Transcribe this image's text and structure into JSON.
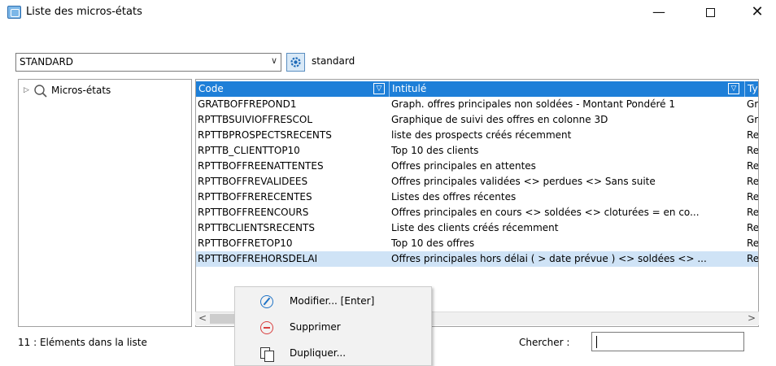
{
  "window": {
    "title": "Liste des micros-états",
    "minimize_glyph": "—",
    "close_glyph": "✕"
  },
  "toolbar": {
    "view_value": "STANDARD",
    "view_name": "standard",
    "dropdown_glyph": "∨"
  },
  "tree": {
    "expand_glyph": "▷",
    "root_label": "Micros-états"
  },
  "grid": {
    "columns": {
      "code": "Code",
      "intitule": "Intitulé",
      "type": "Ty"
    },
    "rows": [
      {
        "code": "GRATBOFFREPOND1",
        "intitule": "Graph. offres principales non soldées - Montant Pondéré 1",
        "type": "Gr"
      },
      {
        "code": "RPTTBSUIVIOFFRESCOL",
        "intitule": "Graphique de suivi des offres en colonne 3D",
        "type": "Gr"
      },
      {
        "code": "RPTTBPROSPECTSRECENTS",
        "intitule": "liste des prospects créés récemment",
        "type": "Re"
      },
      {
        "code": "RPTTB_CLIENTTOP10",
        "intitule": "Top 10 des clients",
        "type": "Re"
      },
      {
        "code": "RPTTBOFFREENATTENTES",
        "intitule": "Offres principales en attentes",
        "type": "Re"
      },
      {
        "code": "RPTTBOFFREVALIDEES",
        "intitule": "Offres principales validées <> perdues <> Sans suite",
        "type": "Re"
      },
      {
        "code": "RPTTBOFFRERECENTES",
        "intitule": "Listes des offres récentes",
        "type": "Re"
      },
      {
        "code": "RPTTBOFFREENCOURS",
        "intitule": "Offres principales en cours <> soldées <> cloturées = en co...",
        "type": "Re"
      },
      {
        "code": "RPTTBCLIENTSRECENTS",
        "intitule": "Liste des clients créés récemment",
        "type": "Re"
      },
      {
        "code": "RPTTBOFFRETOP10",
        "intitule": "Top 10 des offres",
        "type": "Re"
      },
      {
        "code": "RPTTBOFFREHORSDELAI",
        "intitule": "Offres principales hors délai ( > date prévue ) <> soldées <> ...",
        "type": "Re"
      }
    ],
    "scroll_left": "<",
    "scroll_right": ">"
  },
  "footer": {
    "count_text": "11 : Eléments dans la liste",
    "search_label": "Chercher :",
    "search_value": ""
  },
  "context_menu": {
    "items": [
      {
        "label": "Modifier... [Enter]",
        "icon": "edit-icon"
      },
      {
        "label": "Supprimer",
        "icon": "delete-icon"
      },
      {
        "label": "Dupliquer...",
        "icon": "duplicate-icon"
      }
    ]
  },
  "colors": {
    "header_bg": "#1e7fd8",
    "selected_row": "#cfe3f6"
  }
}
